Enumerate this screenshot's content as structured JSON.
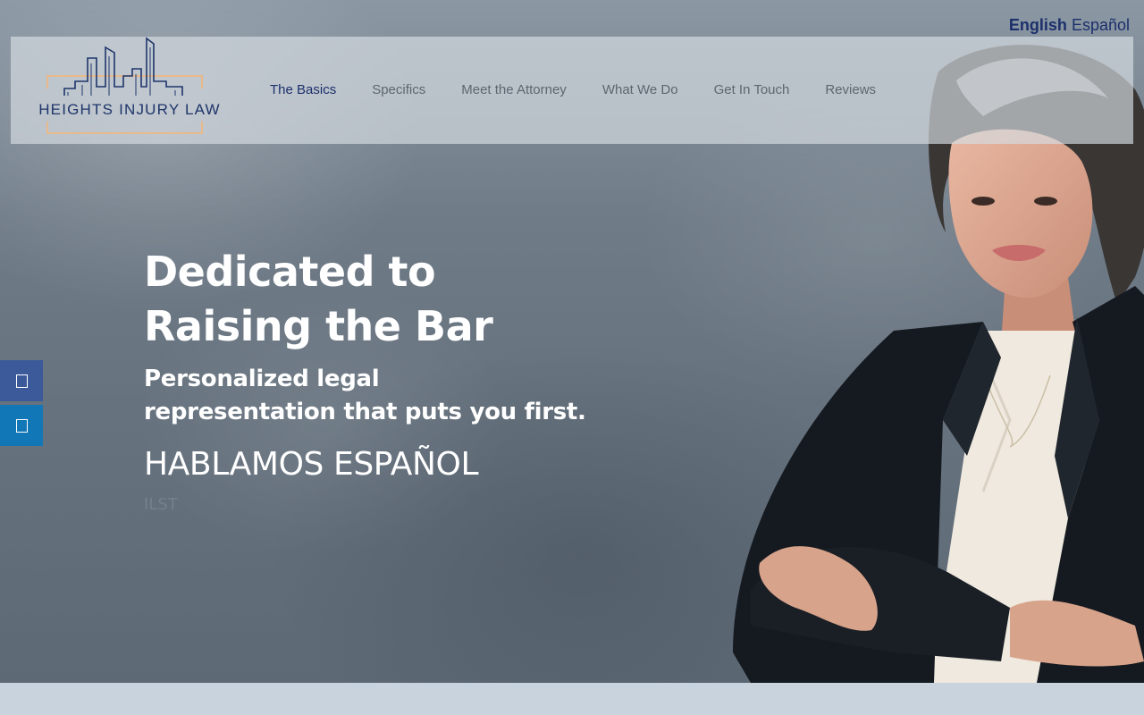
{
  "language_switch": {
    "english": "English",
    "spanish": "Español"
  },
  "logo": {
    "text": "HEIGHTS INJURY LAW"
  },
  "nav": {
    "items": [
      {
        "label": "The Basics",
        "active": true
      },
      {
        "label": "Specifics"
      },
      {
        "label": "Meet the Attorney"
      },
      {
        "label": "What We Do"
      },
      {
        "label": "Get In Touch"
      },
      {
        "label": "Reviews"
      }
    ]
  },
  "hero": {
    "title_line1": "Dedicated to",
    "title_line2": "Raising the Bar",
    "subtitle_line1": "Personalized legal",
    "subtitle_line2_before": "representation that puts ",
    "subtitle_emphasis": "you",
    "subtitle_line2_after": " first.",
    "spanish_line": "HABLAMOS ESPAÑOL",
    "faint_text": "ILST"
  },
  "side_buttons": [
    {
      "icon": "facebook-icon",
      "color": "#3c5a9a"
    },
    {
      "icon": "linkedin-icon",
      "color": "#1277b6"
    }
  ],
  "colors": {
    "brand_navy": "#1c2f6b",
    "logo_gold": "#e8b98a",
    "nav_inactive": "#5e6771",
    "footer_band": "#c9d3dd"
  }
}
